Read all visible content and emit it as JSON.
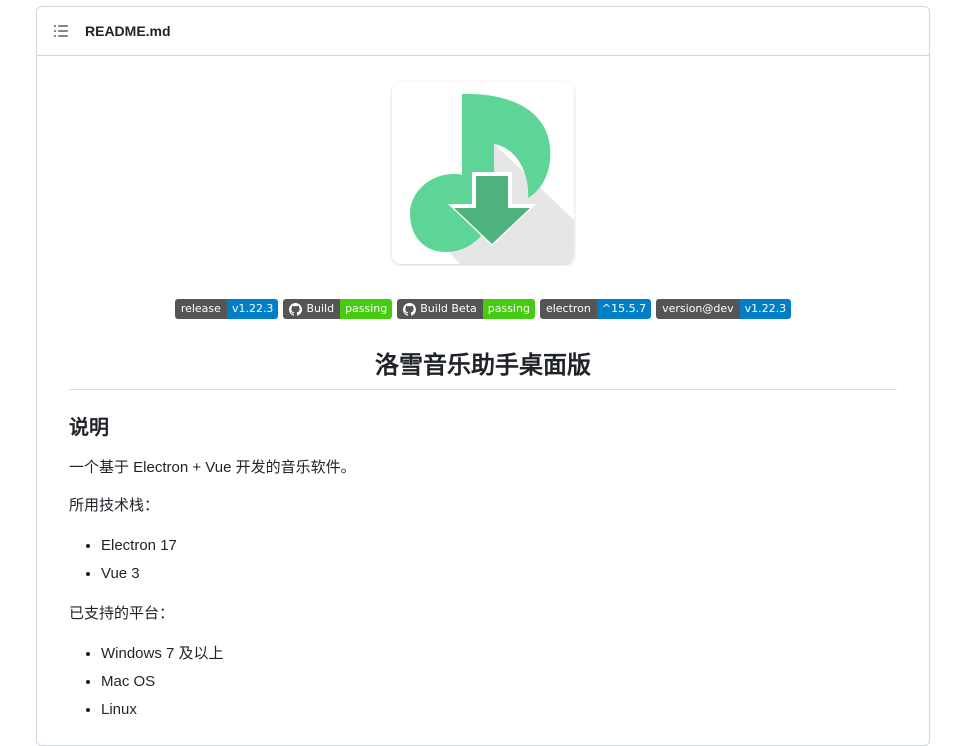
{
  "header": {
    "title": "README.md",
    "toc_icon": "list-unordered-icon"
  },
  "logo": {
    "icon": "music-note-download-icon",
    "colors": {
      "note": "#5dd597",
      "arrow": "#4eb37e",
      "shadow": "#e8e8e8"
    }
  },
  "badges": [
    {
      "left": "release",
      "right": "v1.22.3",
      "color": "#007ec6",
      "icon": ""
    },
    {
      "left": "Build",
      "right": "passing",
      "color": "#44cc11",
      "icon": "github-icon"
    },
    {
      "left": "Build Beta",
      "right": "passing",
      "color": "#44cc11",
      "icon": "github-icon"
    },
    {
      "left": "electron",
      "right": "^15.5.7",
      "color": "#007ec6",
      "icon": ""
    },
    {
      "left": "version@dev",
      "right": "v1.22.3",
      "color": "#007ec6",
      "icon": ""
    }
  ],
  "content": {
    "title": "洛雪音乐助手桌面版",
    "section_heading": "说明",
    "intro": "一个基于 Electron + Vue 开发的音乐软件。",
    "stack_label": "所用技术栈：",
    "stack": [
      "Electron 17",
      "Vue 3"
    ],
    "platforms_label": "已支持的平台：",
    "platforms": [
      "Windows 7 及以上",
      "Mac OS",
      "Linux"
    ]
  }
}
